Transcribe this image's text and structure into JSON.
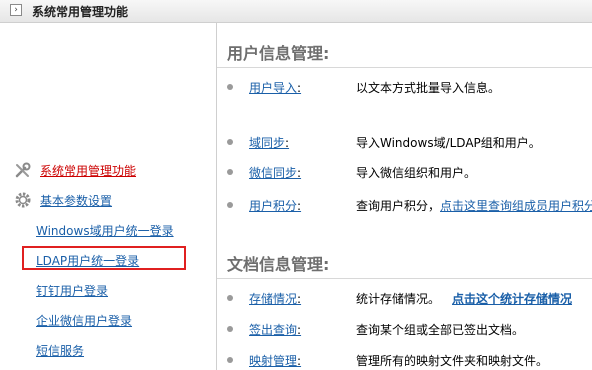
{
  "topbar": {
    "title": "系统常用管理功能",
    "arrow_glyph": "›"
  },
  "sidebar": {
    "items": [
      {
        "label": "系统常用管理功能",
        "icon": "wrench-icon",
        "active": true
      },
      {
        "label": "基本参数设置",
        "icon": "gear-icon",
        "active": false
      },
      {
        "label": "Windows域用户统一登录"
      },
      {
        "label": "LDAP用户统一登录",
        "highlighted": true
      },
      {
        "label": "钉钉用户登录"
      },
      {
        "label": "企业微信用户登录"
      },
      {
        "label": "短信服务"
      }
    ]
  },
  "sections": {
    "user": {
      "title": "用户信息管理:",
      "rows": [
        {
          "link": "用户导入",
          "colon": ":",
          "desc": "以文本方式批量导入信息。"
        },
        {
          "link": "域同步",
          "colon": ":",
          "desc": "导入Windows域/LDAP组和用户。"
        },
        {
          "link": "微信同步",
          "colon": ":",
          "desc": "导入微信组织和用户。"
        },
        {
          "link": "用户积分",
          "colon": ":",
          "desc": "查询用户积分，",
          "extra": "点击这里查询组成员用户积分"
        }
      ]
    },
    "doc": {
      "title": "文档信息管理:",
      "rows": [
        {
          "link": "存储情况",
          "colon": ":",
          "desc": "统计存储情况。",
          "extra": "点击这个统计存储情况"
        },
        {
          "link": "签出查询",
          "colon": ":",
          "desc": "查询某个组或全部已签出文档。"
        },
        {
          "link": "映射管理",
          "colon": ":",
          "desc": "管理所有的映射文件夹和映射文件。"
        }
      ]
    }
  },
  "colors": {
    "link": "#1a5fa8",
    "active": "#cc0000",
    "highlight_border": "#e02020",
    "section_title": "#6e6e6e"
  }
}
